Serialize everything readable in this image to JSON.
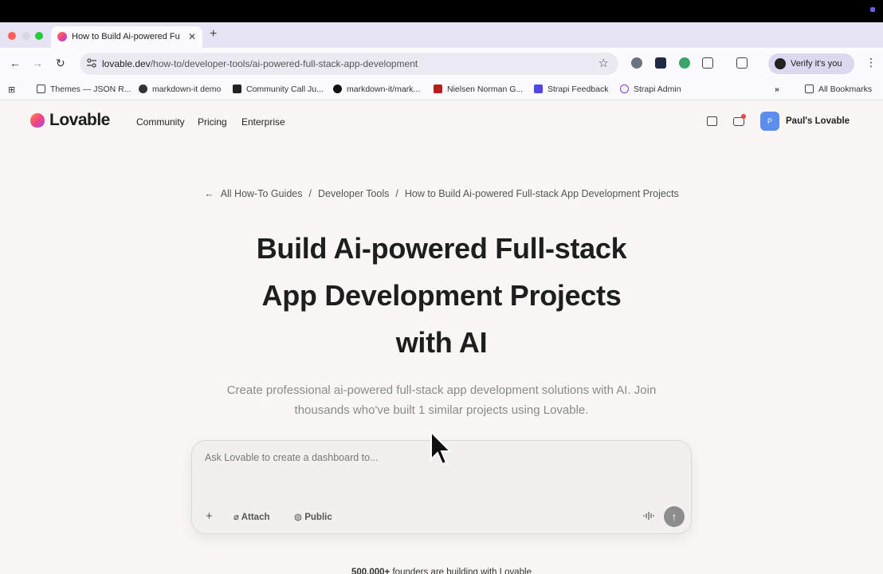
{
  "browser": {
    "tab_title": "How to Build Ai-powered Full-stack",
    "url_host": "lovable.dev",
    "url_path": "/how-to/developer-tools/ai-powered-full-stack-app-development",
    "verify_label": "Verify it's you",
    "bookmarks": [
      {
        "label": "Themes — JSON R...",
        "icon": "document-icon"
      },
      {
        "label": "markdown-it demo",
        "icon": "globe-icon"
      },
      {
        "label": "Community Call Ju...",
        "icon": "strapi-icon"
      },
      {
        "label": "markdown-it/mark...",
        "icon": "github-icon"
      },
      {
        "label": "Nielsen Norman G...",
        "icon": "nng-icon"
      },
      {
        "label": "Strapi Feedback",
        "icon": "strapi-icon"
      },
      {
        "label": "Strapi Admin",
        "icon": "gear-icon"
      }
    ],
    "all_bookmarks_label": "All Bookmarks"
  },
  "header": {
    "brand": "Lovable",
    "nav": [
      "Community",
      "Pricing",
      "Enterprise"
    ],
    "avatar_initial": "P",
    "account_name": "Paul's Lovable"
  },
  "breadcrumb": {
    "back_label": "All How-To Guides",
    "category": "Developer Tools",
    "current": "How to Build Ai-powered Full-stack App Development Projects"
  },
  "hero": {
    "line1": "Build Ai-powered Full-stack",
    "line2": "App Development Projects",
    "line3": "with AI",
    "subtitle": "Create professional ai-powered full-stack app development solutions with AI. Join thousands who've built 1 similar projects using Lovable."
  },
  "prompt": {
    "placeholder": "Ask Lovable to create a dashboard to...",
    "attach_label": "Attach",
    "public_label": "Public"
  },
  "social": {
    "count": "500,000+",
    "text": " founders are building with Lovable"
  },
  "colors": {
    "tab_strip": "#e6e3f2",
    "page_bg": "#f8f7f4",
    "avatar": "#5b8def",
    "send_button": "#8d8d8d"
  }
}
